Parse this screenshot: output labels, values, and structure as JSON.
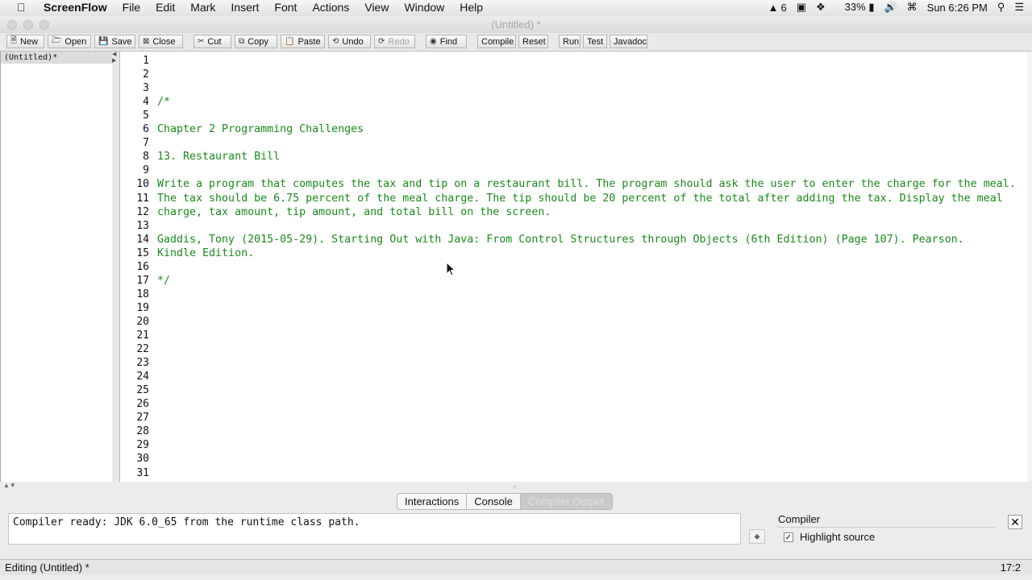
{
  "menubar": {
    "app_name": "ScreenFlow",
    "menus": [
      "File",
      "Edit",
      "Mark",
      "Insert",
      "Font",
      "Actions",
      "View",
      "Window",
      "Help"
    ],
    "adobe_count": "6",
    "battery": "33%",
    "clock": "Sun 6:26 PM"
  },
  "window": {
    "title": "(Untitled) *"
  },
  "toolbar": {
    "new": "New",
    "open": "Open",
    "save": "Save",
    "close": "Close",
    "cut": "Cut",
    "copy": "Copy",
    "paste": "Paste",
    "undo": "Undo",
    "redo": "Redo",
    "find": "Find",
    "compile": "Compile",
    "reset": "Reset",
    "run": "Run",
    "test": "Test",
    "javadoc": "Javadoc"
  },
  "sidebar": {
    "document": "(Untitled)*"
  },
  "editor": {
    "line_numbers": [
      "1",
      "2",
      "3",
      "4",
      "5",
      "6",
      "7",
      "8",
      "9",
      "10",
      "11",
      "12",
      "13",
      "14",
      "15",
      "16",
      "17",
      "18",
      "19",
      "20",
      "21",
      "22",
      "23",
      "24",
      "25",
      "26",
      "27",
      "28",
      "29",
      "30",
      "31"
    ],
    "lines": [
      "",
      "",
      "",
      "/*",
      "",
      "Chapter 2 Programming Challenges",
      "",
      "13. Restaurant Bill",
      "",
      "Write a program that computes the tax and tip on a restaurant bill. The program should ask the user to enter the charge for the meal.",
      "The tax should be 6.75 percent of the meal charge. The tip should be 20 percent of the total after adding the tax. Display the meal",
      "charge, tax amount, tip amount, and total bill on the screen.",
      "",
      "Gaddis, Tony (2015-05-29). Starting Out with Java: From Control Structures through Objects (6th Edition) (Page 107). Pearson.",
      "Kindle Edition.",
      "",
      "*/"
    ],
    "code_color": "#1a8a1a"
  },
  "bottom_tabs": {
    "interactions": "Interactions",
    "console": "Console",
    "compiler_output": "Compiler Output"
  },
  "console": {
    "message": "Compiler ready: JDK 6.0_65 from the runtime class path."
  },
  "compiler_panel": {
    "label": "Compiler",
    "highlight_source": "Highlight source",
    "close": "✕"
  },
  "statusbar": {
    "mode": "Editing (Untitled) *",
    "position": "17:2"
  }
}
